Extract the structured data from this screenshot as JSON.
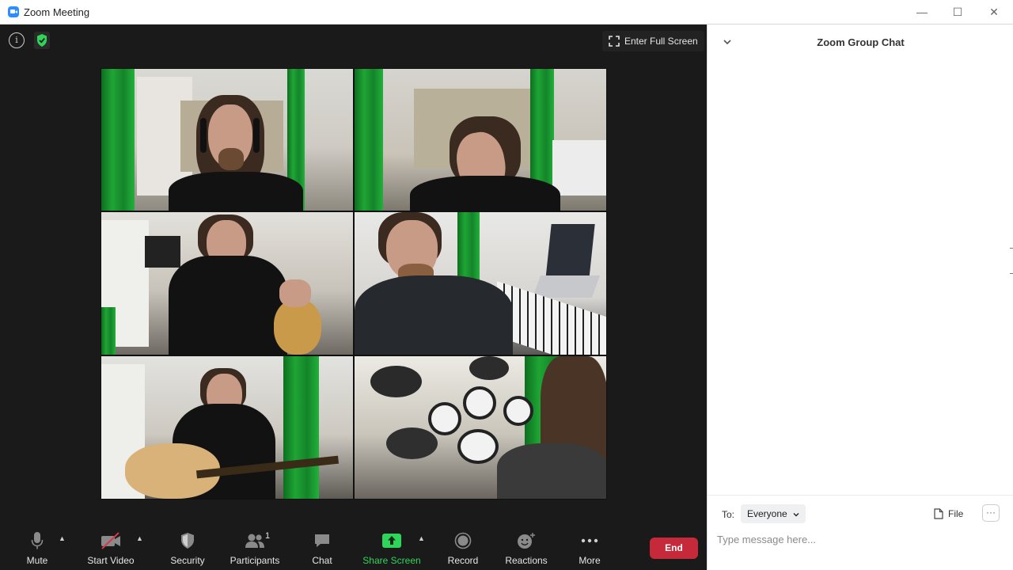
{
  "window": {
    "title": "Zoom Meeting",
    "minimize": "—",
    "maximize": "☐",
    "close": "✕"
  },
  "video": {
    "info_icon": "i",
    "fullscreen_label": "Enter Full Screen",
    "tiles": [
      {
        "name": "participant-1"
      },
      {
        "name": "participant-2"
      },
      {
        "name": "participant-3"
      },
      {
        "name": "participant-4"
      },
      {
        "name": "participant-5"
      },
      {
        "name": "participant-6"
      }
    ]
  },
  "toolbar": {
    "mute": "Mute",
    "start_video": "Start Video",
    "security": "Security",
    "participants": "Participants",
    "participants_count": "1",
    "chat": "Chat",
    "share_screen": "Share Screen",
    "record": "Record",
    "reactions": "Reactions",
    "more": "More",
    "end": "End"
  },
  "chat": {
    "title": "Zoom Group Chat",
    "to_label": "To:",
    "to_value": "Everyone",
    "file_label": "File",
    "more_label": "···",
    "input_placeholder": "Type message here..."
  },
  "colors": {
    "share_green": "#2fd55b",
    "end_red": "#c62a3a",
    "shield_green": "#2fd55b",
    "zoom_blue": "#2d8cff"
  }
}
